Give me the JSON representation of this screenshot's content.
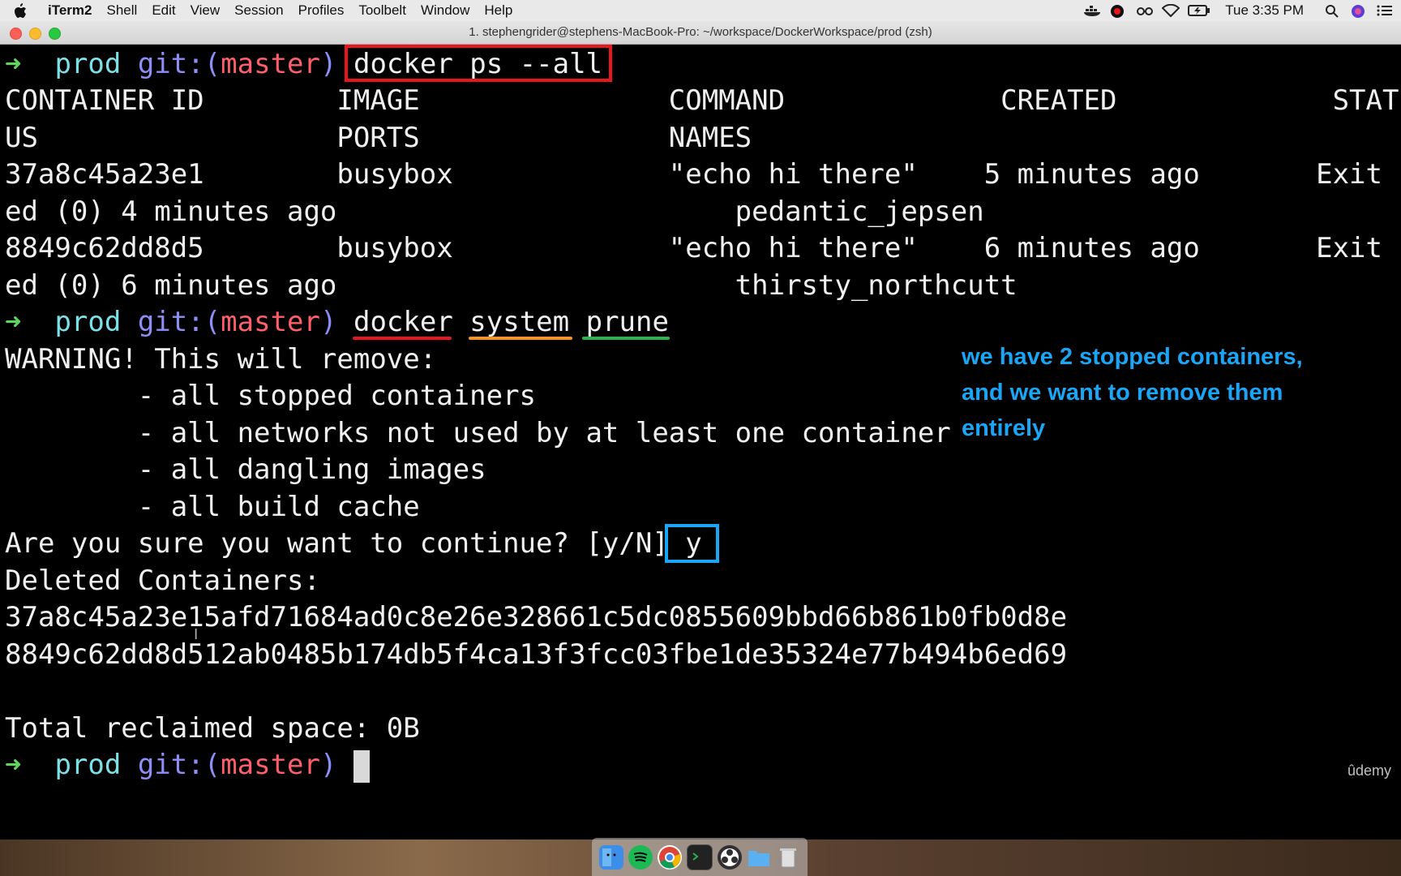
{
  "menubar": {
    "app_name": "iTerm2",
    "items": [
      "Shell",
      "Edit",
      "View",
      "Session",
      "Profiles",
      "Toolbelt",
      "Window",
      "Help"
    ],
    "clock": "Tue 3:35 PM"
  },
  "window": {
    "title": "1. stephengrider@stephens-MacBook-Pro: ~/workspace/DockerWorkspace/prod (zsh)"
  },
  "prompt": {
    "arrow": "➜",
    "dir": "prod",
    "git_open": "git:(",
    "branch": "master",
    "git_close": ")"
  },
  "terminal": {
    "cmd1": "docker ps --all",
    "header1": "CONTAINER ID        IMAGE               COMMAND             CREATED             STAT",
    "header2": "US                  PORTS               NAMES",
    "row1a": "37a8c45a23e1        busybox             \"echo hi there\"    5 minutes ago       Exit",
    "row1b": "ed (0) 4 minutes ago                        pedantic_jepsen",
    "row2a": "8849c62dd8d5        busybox             \"echo hi there\"    6 minutes ago       Exit",
    "row2b": "ed (0) 6 minutes ago                        thirsty_northcutt",
    "cmd2_docker": "docker",
    "cmd2_system": "system",
    "cmd2_prune": "prune",
    "warn": "WARNING! This will remove:",
    "bullet1": "        - all stopped containers",
    "bullet2": "        - all networks not used by at least one container",
    "bullet3": "        - all dangling images",
    "bullet4": "        - all build cache",
    "confirm": "Are you sure you want to continue? [y/N]",
    "answer": "y",
    "deleted": "Deleted Containers:",
    "id1": "37a8c45a23e15afd71684ad0c8e26e328661c5dc0855609bbd66b861b0fb0d8e",
    "id2": "8849c62dd8d512ab0485b174db5f4ca13f3fcc03fbe1de35324e77b494b6ed69",
    "reclaimed": "Total reclaimed space: 0B"
  },
  "annotation": {
    "note": "we have 2 stopped containers, and we want to remove them entirely"
  },
  "watermark": "ûdemy",
  "colors": {
    "red_box": "#e8161c",
    "blue_box": "#1aa5f5",
    "underline_docker": "#e8161c",
    "underline_system": "#f7921c",
    "underline_prune": "#2cb34a"
  },
  "dock_icons": [
    "finder-icon",
    "spotify-icon",
    "chrome-icon",
    "terminal-icon",
    "obs-icon",
    "folder-icon",
    "trash-icon"
  ]
}
